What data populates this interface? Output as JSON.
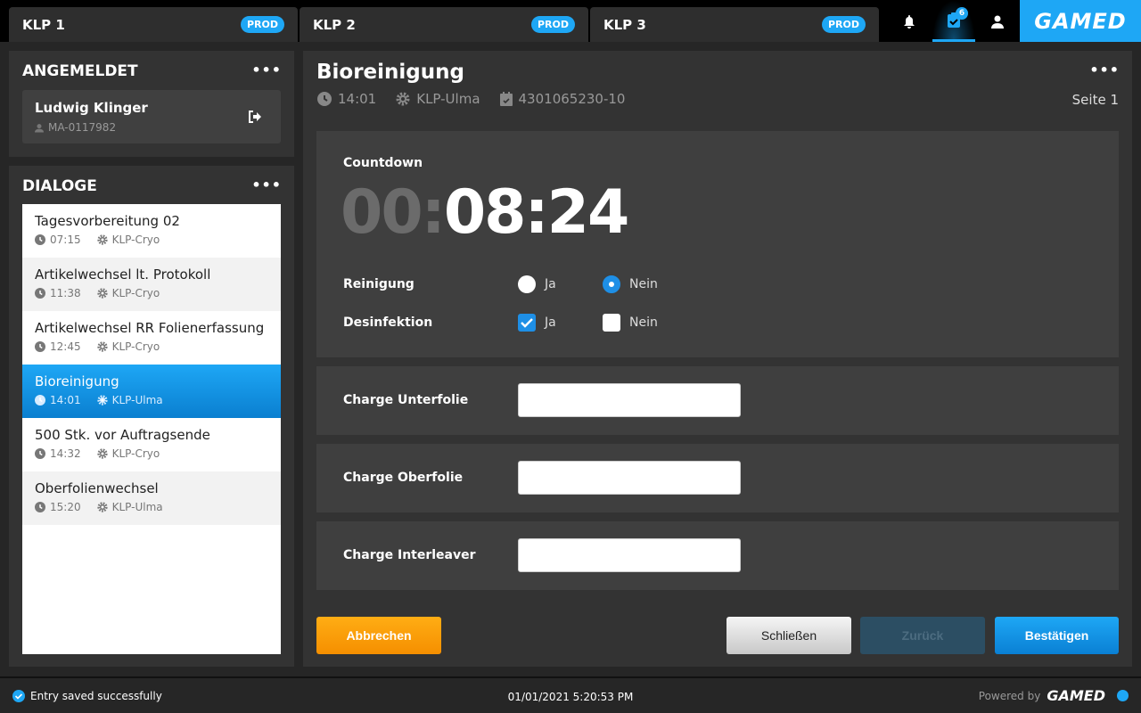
{
  "tabs": [
    {
      "label": "KLP 1",
      "badge": "PROD"
    },
    {
      "label": "KLP 2",
      "badge": "PROD"
    },
    {
      "label": "KLP 3",
      "badge": "PROD"
    }
  ],
  "topbar": {
    "task_count": "6",
    "logo": "GAMED"
  },
  "logged_in": {
    "title": "ANGEMELDET",
    "more": "•••",
    "user_name": "Ludwig Klinger",
    "user_id": "MA-0117982"
  },
  "dialogs": {
    "title": "DIALOGE",
    "more": "•••",
    "items": [
      {
        "title": "Tagesvorbereitung 02",
        "time": "07:15",
        "machine": "KLP-Cryo"
      },
      {
        "title": "Artikelwechsel lt. Protokoll",
        "time": "11:38",
        "machine": "KLP-Cryo"
      },
      {
        "title": "Artikelwechsel RR Folienerfassung",
        "time": "12:45",
        "machine": "KLP-Cryo"
      },
      {
        "title": "Bioreinigung",
        "time": "14:01",
        "machine": "KLP-Ulma"
      },
      {
        "title": "500 Stk. vor Auftragsende",
        "time": "14:32",
        "machine": "KLP-Cryo"
      },
      {
        "title": "Oberfolienwechsel",
        "time": "15:20",
        "machine": "KLP-Ulma"
      }
    ]
  },
  "main": {
    "title": "Bioreinigung",
    "more": "•••",
    "time": "14:01",
    "machine": "KLP-Ulma",
    "order": "4301065230-10",
    "page": "Seite 1",
    "countdown": {
      "label": "Countdown",
      "hours": "00:",
      "rest": "08:24"
    },
    "reinigung": {
      "label": "Reinigung",
      "yes": "Ja",
      "no": "Nein",
      "value": "Nein"
    },
    "desinfektion": {
      "label": "Desinfektion",
      "yes": "Ja",
      "no": "Nein",
      "value": "Ja"
    },
    "fields": [
      {
        "label": "Charge Unterfolie",
        "value": ""
      },
      {
        "label": "Charge Oberfolie",
        "value": ""
      },
      {
        "label": "Charge Interleaver",
        "value": ""
      }
    ],
    "buttons": {
      "cancel": "Abbrechen",
      "close": "Schließen",
      "back": "Zurück",
      "confirm": "Bestätigen"
    }
  },
  "footer": {
    "status": "Entry saved successfully",
    "datetime": "01/01/2021 5:20:53 PM",
    "powered": "Powered by",
    "logo": "GAMED"
  },
  "colors": {
    "accent": "#1ea7f5",
    "cancel": "#f7a000"
  }
}
